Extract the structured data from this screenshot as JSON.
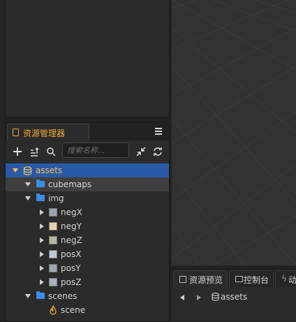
{
  "assets_panel": {
    "tab_label": "资源管理器",
    "search": {
      "placeholder": "搜索名称...",
      "value": ""
    },
    "tree": {
      "root": {
        "label": "assets"
      },
      "cubemaps": {
        "label": "cubemaps"
      },
      "img": {
        "label": "img",
        "items": [
          {
            "label": "negX",
            "color": "#9aa2b0"
          },
          {
            "label": "negY",
            "color": "#e3d1b0"
          },
          {
            "label": "negZ",
            "color": "#b7b2a7"
          },
          {
            "label": "posX",
            "color": "#c0c7d2"
          },
          {
            "label": "posY",
            "color": "#9fa6b4"
          },
          {
            "label": "posZ",
            "color": "#aab0bd"
          }
        ]
      },
      "scenes": {
        "label": "scenes"
      },
      "scene": {
        "label": "scene"
      }
    }
  },
  "bottom_panel": {
    "tabs": [
      {
        "label": "资源预览"
      },
      {
        "label": "控制台"
      },
      {
        "label": "动"
      }
    ],
    "breadcrumb": "assets"
  },
  "colors": {
    "accent": "#f0a93a",
    "selection": "#2a5aa7",
    "folder": "#3a8ee6",
    "panel_bg": "#2b2b2b",
    "scene_bg": "#323232"
  }
}
